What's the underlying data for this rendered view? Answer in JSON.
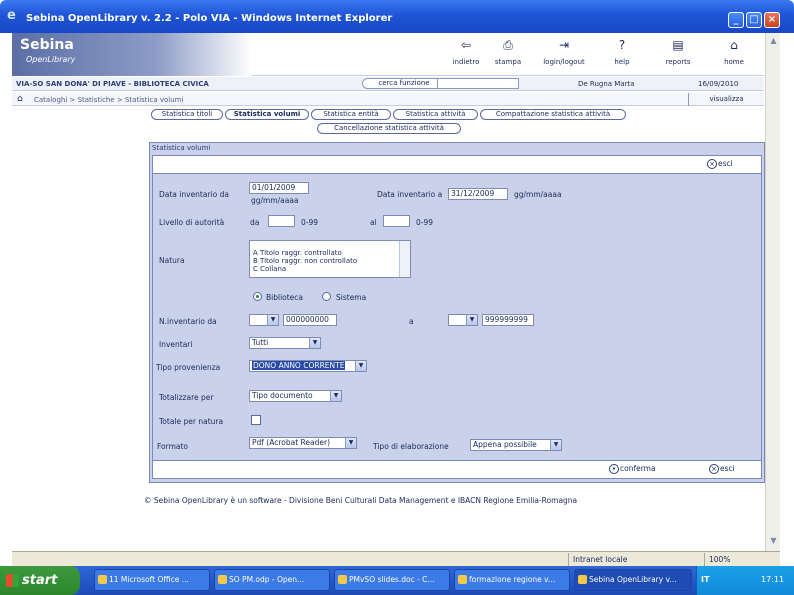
{
  "window": {
    "title": "Sebina OpenLibrary v. 2.2 - Polo VIA - Windows Internet Explorer",
    "minimize": "_",
    "maximize": "□",
    "close": "×"
  },
  "app": {
    "logo_main": "Sebina",
    "logo_sub": "OpenLibrary",
    "toolbar": [
      {
        "label": "indietro",
        "icon": "back-icon"
      },
      {
        "label": "stampa",
        "icon": "print-icon"
      },
      {
        "label": "login/logout",
        "icon": "login-icon"
      },
      {
        "label": "help",
        "icon": "help-icon"
      },
      {
        "label": "reports",
        "icon": "reports-icon"
      },
      {
        "label": "home",
        "icon": "home-icon"
      }
    ],
    "toolbar_glyphs": [
      "⇦",
      "⎙",
      "⇥",
      "?",
      "▤",
      "⌂"
    ]
  },
  "infobar": {
    "library": "VIA-SO SAN DONA' DI PIAVE - BIBLIOTECA CIVICA",
    "search_button": "cerca funzione",
    "search_value": "",
    "user": "De Rugna Marta",
    "date": "16/09/2010"
  },
  "breadcrumb": {
    "path": "Cataloghi > Statistiche > Statistica volumi",
    "visualize": "visualizza"
  },
  "tabs": [
    {
      "label": "Statistica titoli",
      "active": false
    },
    {
      "label": "Statistica volumi",
      "active": true
    },
    {
      "label": "Statistica entità",
      "active": false
    },
    {
      "label": "Statistica attività",
      "active": false
    },
    {
      "label": "Compattazione statistica attività",
      "active": false
    },
    {
      "label": "Cancellazione statistica attività",
      "active": false
    }
  ],
  "form": {
    "section_title": "Statistica volumi",
    "exit_label": "esci",
    "confirm_label": "conferma",
    "date_from_label": "Data inventario da",
    "date_from_value": "01/01/2009",
    "date_from_hint": "gg/mm/aaaa",
    "date_to_label": "Data inventario a",
    "date_to_value": "31/12/2009",
    "date_to_hint": "gg/mm/aaaa",
    "level_label": "Livello di autorità",
    "level_from_label": "da",
    "level_from_value": "",
    "level_from_hint": "0-99",
    "level_to_label": "al",
    "level_to_value": "",
    "level_to_hint": "0-99",
    "nature_label": "Natura",
    "nature_options": [
      "A   Titolo raggr. controllato",
      "B   Titolo raggr. non controllato",
      "C   Collana"
    ],
    "scope_options": [
      "Biblioteca",
      "Sistema"
    ],
    "scope_selected": "Biblioteca",
    "inv_label": "N.inventario da",
    "inv_from_prefix": "",
    "inv_from_value": "000000000",
    "inv_to_label": "a",
    "inv_to_prefix": "",
    "inv_to_value": "999999999",
    "inventari_label": "Inventari",
    "inventari_value": "Tutti",
    "provenienza_label": "Tipo provenienza",
    "provenienza_value": "DONO ANNO CORRENTE",
    "totals_label": "Totalizzare per",
    "totals_value": "Tipo documento",
    "totals_nature_label": "Totale per natura",
    "format_label": "Formato",
    "format_value": "Pdf (Acrobat Reader)",
    "elab_label": "Tipo di elaborazione",
    "elab_value": "Appena possibile"
  },
  "footer": "© Sebina OpenLibrary è un software - Divisione Beni Culturali Data Management e IBACN Regione Emilia-Romagna",
  "statusbar": {
    "zone": "Intranet locale",
    "zoom": "100%"
  },
  "taskbar": {
    "start": "start",
    "items": [
      {
        "label": "11 Microsoft Office ...",
        "active": false
      },
      {
        "label": "SO PM.odp - Open...",
        "active": false
      },
      {
        "label": "PMvSO slides.doc - C...",
        "active": false
      },
      {
        "label": "formazione regione v...",
        "active": false
      },
      {
        "label": "Sebina OpenLibrary v...",
        "active": true
      }
    ],
    "lang": "IT",
    "clock": "17:11"
  },
  "colors": {
    "accent": "#274ba6",
    "panel": "#c9d2ea",
    "titlebar": "#1f55d6"
  }
}
